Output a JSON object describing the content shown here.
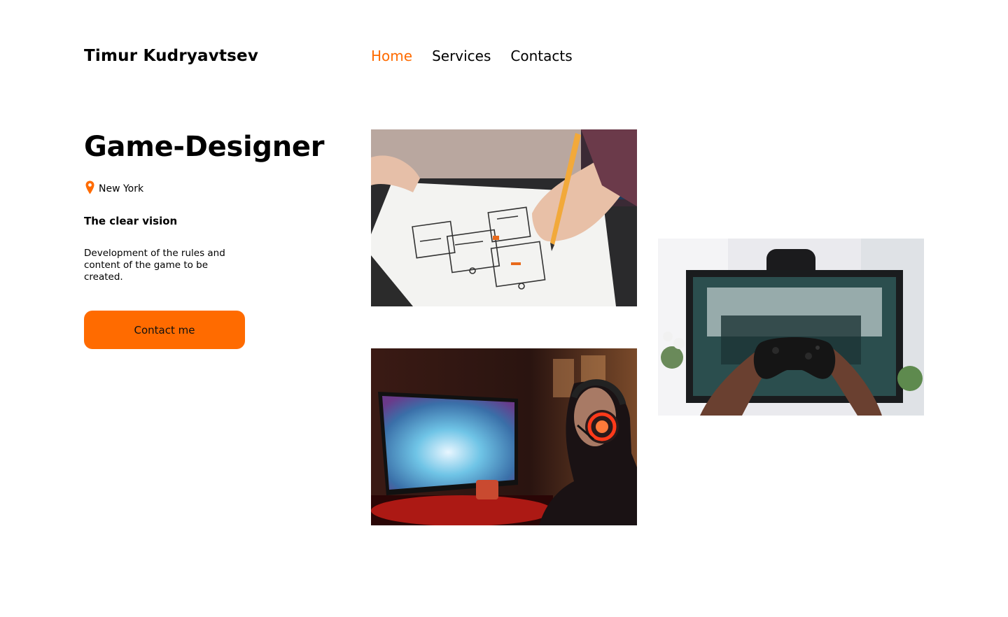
{
  "header": {
    "logo": "Timur Kudryavtsev",
    "nav": [
      {
        "label": "Home",
        "active": true
      },
      {
        "label": "Services",
        "active": false
      },
      {
        "label": "Contacts",
        "active": false
      }
    ]
  },
  "hero": {
    "title": "Game-Designer",
    "location": "New York",
    "subtitle": "The clear vision",
    "description": "Development of the rules and content of the game to be created.",
    "cta_label": "Contact me"
  },
  "images": [
    {
      "name": "sketching-wireframes-photo"
    },
    {
      "name": "gamer-with-headset-photo"
    },
    {
      "name": "gamepad-in-front-of-tv-photo"
    }
  ],
  "colors": {
    "accent": "#ff6b00",
    "text": "#000000",
    "background": "#ffffff"
  },
  "icons": {
    "location": "map-pin-icon"
  }
}
